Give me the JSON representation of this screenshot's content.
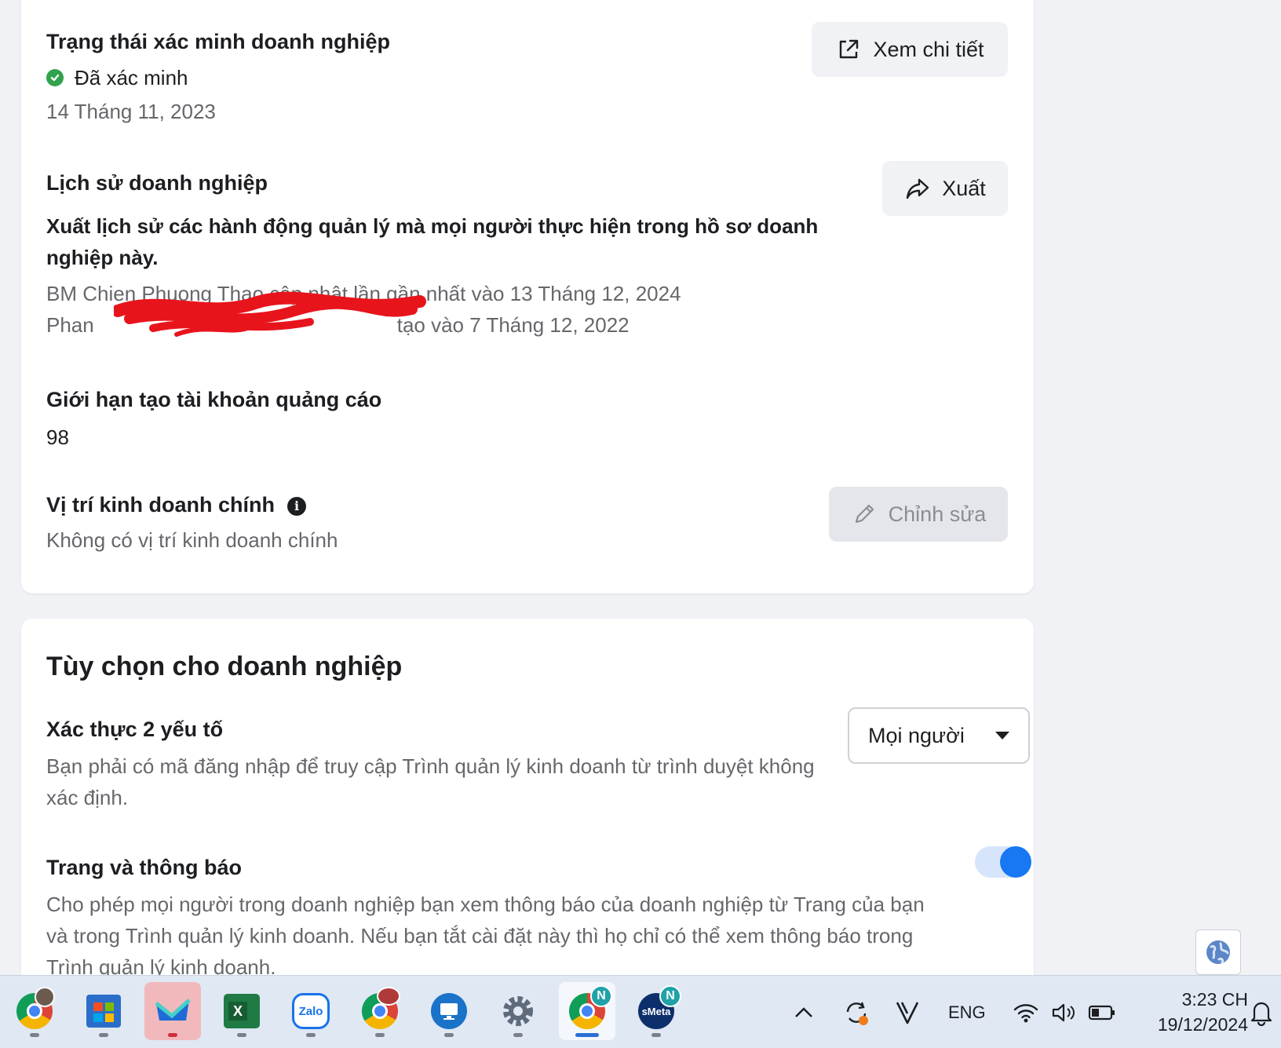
{
  "verification": {
    "title": "Trạng thái xác minh doanh nghiệp",
    "status": "Đã xác minh",
    "date": "14 Tháng 11, 2023",
    "button_label": "Xem chi tiết"
  },
  "history": {
    "title": "Lịch sử doanh nghiệp",
    "description": "Xuất lịch sử các hành động quản lý mà mọi người thực hiện trong hồ sơ doanh nghiệp này.",
    "updated": "BM Chien Phuong Thao cập nhật lần gần nhất vào 13 Tháng 12, 2024",
    "created_prefix": "Phan",
    "created_suffix": "tạo vào 7 Tháng 12, 2022",
    "button_label": "Xuất"
  },
  "ad_limit": {
    "title": "Giới hạn tạo tài khoản quảng cáo",
    "value": "98"
  },
  "location": {
    "title": "Vị trí kinh doanh chính",
    "info_icon": "i",
    "value": "Không có vị trí kinh doanh chính",
    "button_label": "Chỉnh sửa"
  },
  "options": {
    "title": "Tùy chọn cho doanh nghiệp",
    "two_factor": {
      "title": "Xác thực 2 yếu tố",
      "description": "Bạn phải có mã đăng nhập để truy cập Trình quản lý kinh doanh từ trình duyệt không xác định.",
      "select_value": "Mọi người"
    },
    "pages_notifications": {
      "title": "Trang và thông báo",
      "description": "Cho phép mọi người trong doanh nghiệp bạn xem thông báo của doanh nghiệp từ Trang của bạn và trong Trình quản lý kinh doanh. Nếu bạn tắt cài đặt này thì họ chỉ có thể xem thông báo trong Trình quản lý kinh doanh.",
      "toggle_on": true
    }
  },
  "taskbar": {
    "apps": [
      {
        "name": "chrome-profile",
        "icon": "chrome-icon"
      },
      {
        "name": "microsoft-store",
        "icon": "store-icon"
      },
      {
        "name": "mail-app",
        "icon": "mail-icon"
      },
      {
        "name": "excel",
        "icon": "excel-icon",
        "label": "X"
      },
      {
        "name": "zalo",
        "icon": "zalo-icon",
        "label": "Zalo"
      },
      {
        "name": "chrome-profile-2",
        "icon": "chrome-icon"
      },
      {
        "name": "remote-desktop",
        "icon": "monitor-icon"
      },
      {
        "name": "settings",
        "icon": "gear-icon"
      },
      {
        "name": "chrome-n",
        "icon": "chrome-icon",
        "badge": "N"
      },
      {
        "name": "smeta",
        "icon": "smeta-icon",
        "label": "sMeta",
        "badge": "N"
      }
    ],
    "language": "ENG",
    "time": "3:23 CH",
    "date": "19/12/2024"
  },
  "colors": {
    "accent": "#1877f2",
    "verified": "#31a24c",
    "redaction": "#e8141c"
  }
}
